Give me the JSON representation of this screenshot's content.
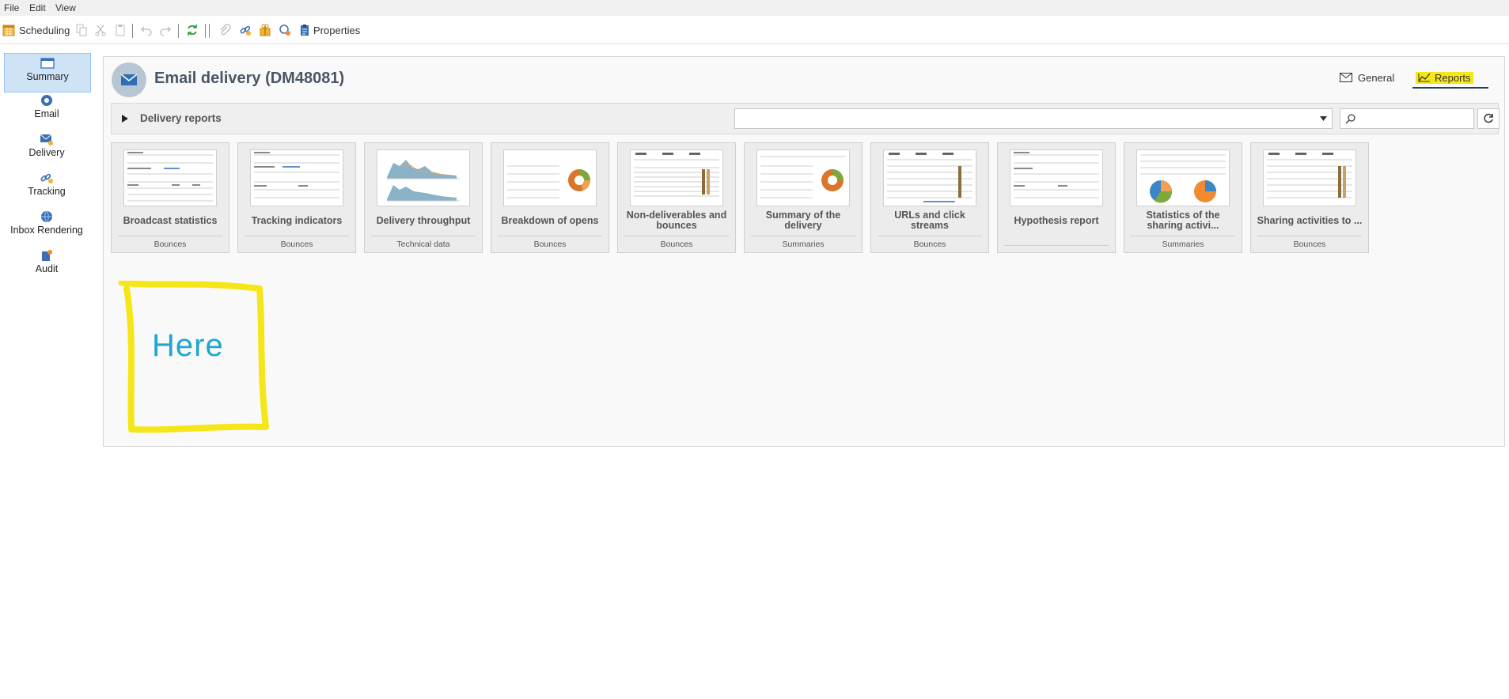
{
  "menu": {
    "file": "File",
    "edit": "Edit",
    "view": "View"
  },
  "toolbar": {
    "scheduling": "Scheduling",
    "properties": "Properties"
  },
  "nav": {
    "items": [
      {
        "label": "Summary"
      },
      {
        "label": "Email"
      },
      {
        "label": "Delivery"
      },
      {
        "label": "Tracking"
      },
      {
        "label": "Inbox Rendering"
      },
      {
        "label": "Audit"
      }
    ]
  },
  "header": {
    "title": "Email delivery (DM48081)"
  },
  "tabs": {
    "general": "General",
    "reports": "Reports"
  },
  "section": {
    "title": "Delivery reports"
  },
  "reports": [
    {
      "name": "Broadcast statistics",
      "category": "Bounces"
    },
    {
      "name": "Tracking indicators",
      "category": "Bounces"
    },
    {
      "name": "Delivery throughput",
      "category": "Technical data"
    },
    {
      "name": "Breakdown of opens",
      "category": "Bounces"
    },
    {
      "name": "Non-deliverables and bounces",
      "category": "Bounces"
    },
    {
      "name": "Summary of the delivery",
      "category": "Summaries"
    },
    {
      "name": "URLs and click streams",
      "category": "Bounces"
    },
    {
      "name": "Hypothesis report",
      "category": ""
    },
    {
      "name": "Statistics of the sharing activi...",
      "category": "Summaries"
    },
    {
      "name": "Sharing activities to ...",
      "category": "Bounces"
    }
  ],
  "annotation": {
    "text": "Here",
    "color": "#f5e61a"
  },
  "colors": {
    "accent": "#cfe3f7",
    "highlight": "#f5e61a",
    "annotation_text": "#20a6cf"
  }
}
